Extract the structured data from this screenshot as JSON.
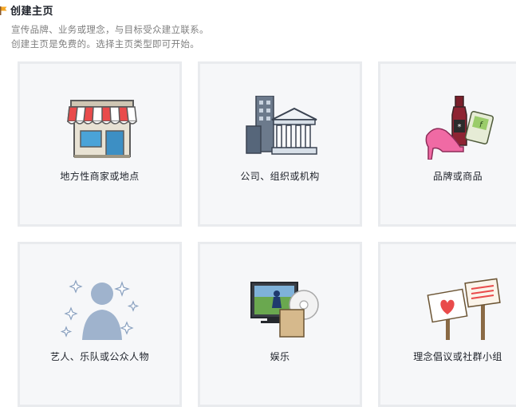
{
  "header": {
    "title": "创建主页",
    "subtitle_line1": "宣传品牌、业务或理念，与目标受众建立联系。",
    "subtitle_line2": "创建主页是免费的。选择主页类型即可开始。"
  },
  "categories": [
    {
      "label": "地方性商家或地点",
      "icon": "storefront-icon"
    },
    {
      "label": "公司、组织或机构",
      "icon": "buildings-icon"
    },
    {
      "label": "品牌或商品",
      "icon": "products-icon"
    },
    {
      "label": "艺人、乐队或公众人物",
      "icon": "person-silhouette-icon"
    },
    {
      "label": "娱乐",
      "icon": "tv-and-disc-icon"
    },
    {
      "label": "理念倡议或社群小组",
      "icon": "picket-signs-icon"
    }
  ],
  "colors": {
    "tile_bg": "#f6f7f9",
    "tile_border": "#e9ebee",
    "awning_red": "#e94b4b",
    "flag_orange": "#f5a623"
  }
}
